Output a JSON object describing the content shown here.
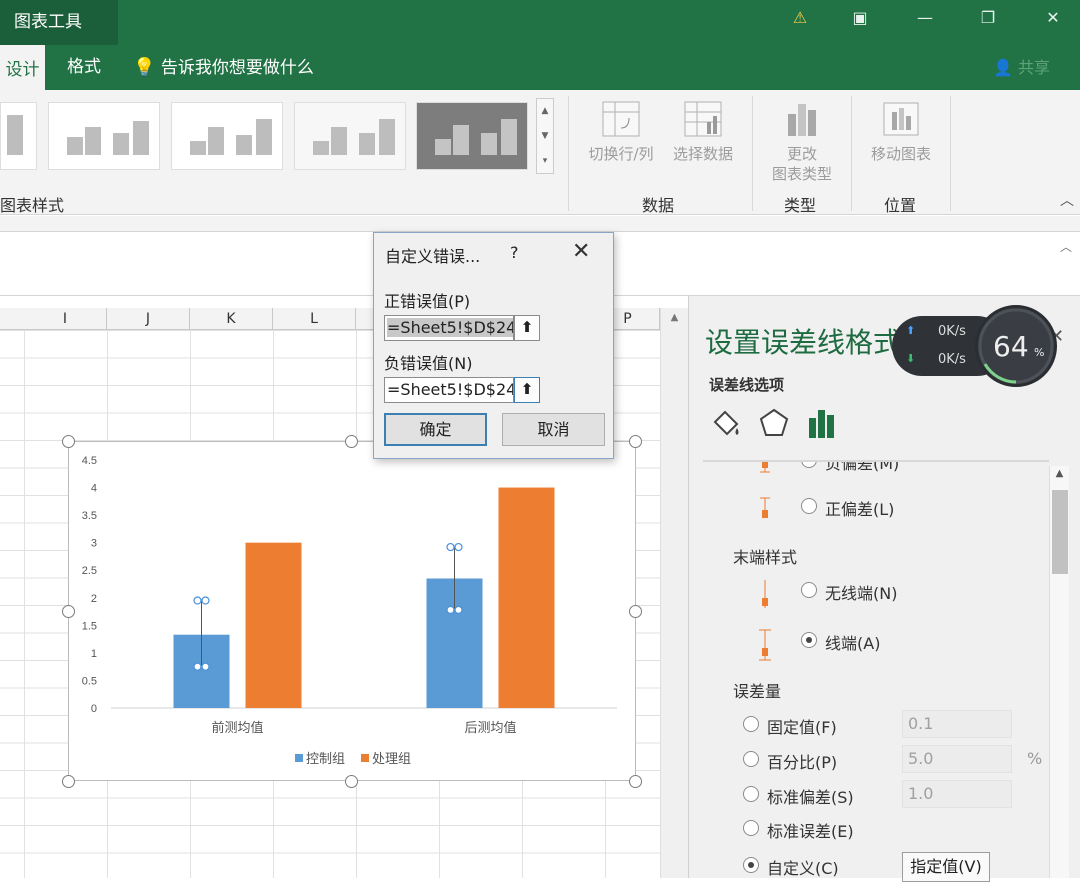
{
  "titlebar": {
    "context_label": "图表工具"
  },
  "tabs": {
    "design": "设计",
    "format": "格式",
    "tell_me": "告诉我你想要做什么",
    "share": "共享"
  },
  "ribbon": {
    "styles_group": "图表样式",
    "switch_row_col": "切换行/列",
    "select_data": "选择数据",
    "data_group": "数据",
    "change_type_1": "更改",
    "change_type_2": "图表类型",
    "type_group": "类型",
    "move_chart": "移动图表",
    "location_group": "位置"
  },
  "sheet": {
    "columns": [
      "I",
      "J",
      "K",
      "L",
      "",
      "",
      "P"
    ]
  },
  "dialog": {
    "title": "自定义错误...",
    "help": "?",
    "positive_label": "正错误值(P)",
    "positive_value": "=Sheet5!$D$24",
    "negative_label": "负错误值(N)",
    "negative_value": "=Sheet5!$D$24",
    "ok": "确定",
    "cancel": "取消"
  },
  "pane": {
    "title": "设置误差线格式",
    "subtitle": "误差线选项",
    "direction_partial": "负偏差(M)",
    "plus": "正偏差(L)",
    "end_style": "末端样式",
    "no_cap": "无线端(N)",
    "cap": "线端(A)",
    "amount": "误差量",
    "fixed": "固定值(F)",
    "fixed_val": "0.1",
    "percent": "百分比(P)",
    "percent_val": "5.0",
    "percent_unit": "%",
    "stddev": "标准偏差(S)",
    "stddev_val": "1.0",
    "stderr": "标准误差(E)",
    "custom": "自定义(C)",
    "specify": "指定值(V)"
  },
  "widget": {
    "up": "0K/s",
    "down": "0K/s",
    "percent": "64",
    "unit": "%"
  },
  "colors": {
    "excel_green": "#217346",
    "series1": "#5b9bd5",
    "series2": "#ed7d31"
  },
  "chart_data": {
    "type": "bar",
    "categories": [
      "前测均值",
      "后测均值"
    ],
    "series": [
      {
        "name": "控制组",
        "values": [
          1.33,
          2.35
        ],
        "error_upper": [
          1.95,
          2.92
        ],
        "error_lower": [
          0.75,
          1.78
        ]
      },
      {
        "name": "处理组",
        "values": [
          3.0,
          4.0
        ]
      }
    ],
    "y_ticks": [
      "0",
      "0.5",
      "1",
      "1.5",
      "2",
      "2.5",
      "3",
      "3.5",
      "4",
      "4.5"
    ],
    "ylim": [
      0,
      4.5
    ],
    "legend": "bottom"
  }
}
